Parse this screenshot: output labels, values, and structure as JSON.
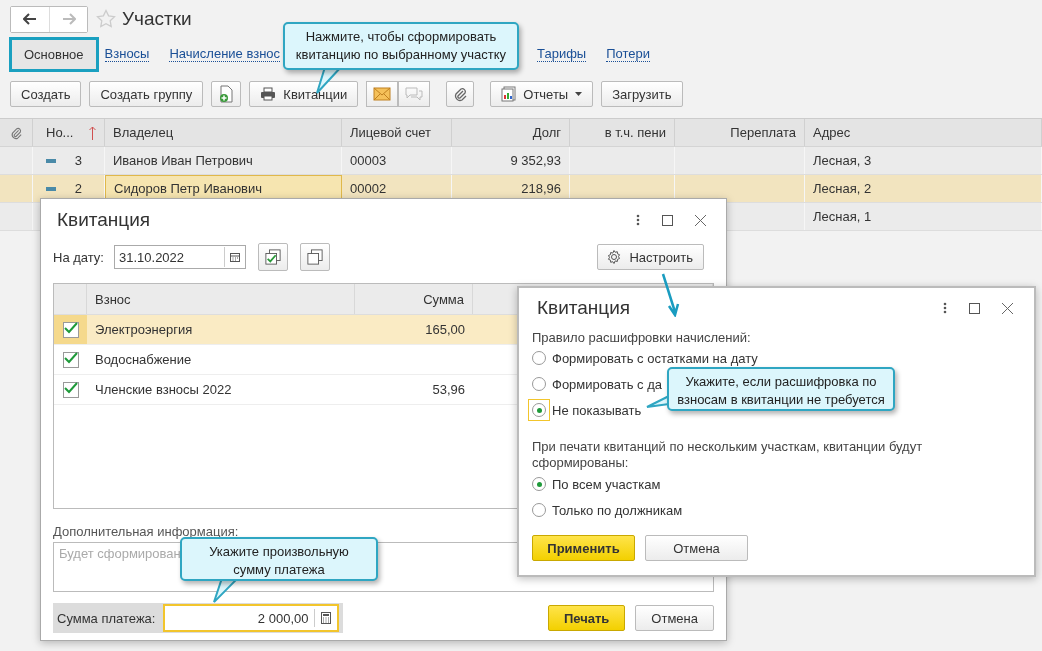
{
  "page": {
    "title": "Участки"
  },
  "tabs": [
    {
      "label": "Основное",
      "selected": true
    },
    {
      "label": "Взносы",
      "selected": false
    },
    {
      "label": "Начисление взнос",
      "selected": false
    },
    {
      "label": "Тарифы",
      "selected": false
    },
    {
      "label": "Потери",
      "selected": false
    }
  ],
  "toolbar": [
    {
      "kind": "plain",
      "label": "Создать"
    },
    {
      "kind": "plain",
      "label": "Создать группу"
    },
    {
      "kind": "add"
    },
    {
      "kind": "print",
      "label": "Квитанции"
    },
    {
      "kind": "mail"
    },
    {
      "kind": "clip"
    },
    {
      "kind": "menu",
      "label": "Отчеты"
    },
    {
      "kind": "plain",
      "label": "Загрузить"
    }
  ],
  "table": {
    "columns": [
      {
        "kind": "clip",
        "sorted": false
      },
      {
        "label": "Но...",
        "sorted": true
      },
      {
        "label": "Владелец",
        "sorted": false
      },
      {
        "label": "Лицевой счет",
        "sorted": false
      },
      {
        "label": "Долг",
        "sorted": false
      },
      {
        "label": "в т.ч. пени",
        "sorted": false
      },
      {
        "label": "Переплата",
        "sorted": false
      },
      {
        "label": "Адрес",
        "sorted": false
      }
    ],
    "rows": [
      {
        "number": "3",
        "owner": "Иванов Иван Петрович",
        "account": "00003",
        "debt": "9 352,93",
        "address": "Лесная, 3",
        "selected": false
      },
      {
        "number": "2",
        "owner": "Сидоров Петр Иванович",
        "account": "00002",
        "debt": "218,96",
        "address": "Лесная, 2",
        "selected": true
      },
      {
        "address": "Лесная, 1",
        "selected": false
      }
    ]
  },
  "receipt_dialog": {
    "title": "Квитанция",
    "date_label": "На дату:",
    "date": "31.10.2022",
    "configure": "Настроить",
    "columns": [
      "Взнос",
      "Сумма"
    ],
    "rows": [
      {
        "checked": true,
        "name": "Электроэнергия",
        "amount": "165,00",
        "selected": true
      },
      {
        "checked": true,
        "name": "Водоснабжение",
        "selected": false
      },
      {
        "checked": true,
        "name": "Членские взносы 2022",
        "amount": "53,96",
        "selected": false
      }
    ],
    "info_label": "Дополнительная информация:",
    "info_placeholder": "Будет сформирован",
    "sum_label": "Сумма платежа:",
    "sum": "2 000,00",
    "buttons": [
      "Печать",
      "Отмена"
    ]
  },
  "settings_dialog": {
    "title": "Квитанция",
    "group1_label": "Правило расшифровки начислений:",
    "group1": [
      {
        "label": "Формировать с остатками на дату",
        "selected": false
      },
      {
        "label": "Формировать с да",
        "selected": false
      },
      {
        "label": "Не показывать",
        "selected": true
      }
    ],
    "group2_label": "При печати квитанций по нескольким участкам, квитанции будут сформированы:",
    "group2": [
      {
        "label": "По всем участкам",
        "selected": true
      },
      {
        "label": "Только по должникам",
        "selected": false
      }
    ],
    "buttons": [
      "Применить",
      "Отмена"
    ]
  },
  "callouts": [
    "Нажмите, чтобы сформировать квитанцию по выбранному участку",
    "Укажите, если расшифровка по взносам в квитанции не требуется",
    "Укажите произвольную сумму платежа"
  ]
}
